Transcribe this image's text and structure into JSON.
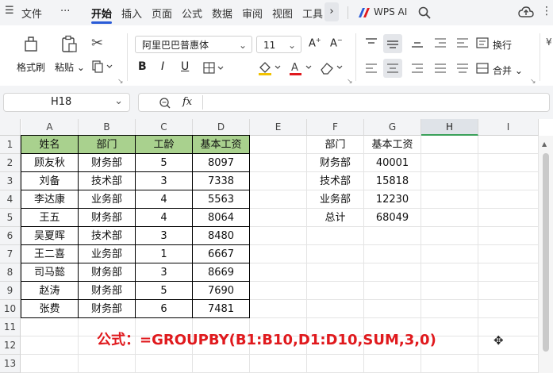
{
  "menu": {
    "file_label": "文件",
    "more_label": "···",
    "tabs": [
      "开始",
      "插入",
      "页面",
      "公式",
      "数据",
      "审阅",
      "视图",
      "工具"
    ],
    "active_tab": "开始",
    "wps_ai_label": "WPS AI"
  },
  "ribbon": {
    "format_painter_label": "格式刷",
    "paste_label": "粘贴",
    "font_name": "阿里巴巴普惠体",
    "font_size": "11",
    "wrap_label": "换行",
    "merge_label": "合并",
    "bold_glyph": "B",
    "italic_glyph": "I",
    "underline_glyph": "U"
  },
  "formula_bar": {
    "cell_ref": "H18",
    "fx_label": "fx",
    "value": ""
  },
  "grid": {
    "columns": [
      "A",
      "B",
      "C",
      "D",
      "E",
      "F",
      "G",
      "H",
      "I"
    ],
    "selected_column": "H",
    "rows": [
      "1",
      "2",
      "3",
      "4",
      "5",
      "6",
      "7",
      "8",
      "9",
      "10",
      "11",
      "12",
      "13"
    ],
    "table": {
      "header": [
        "姓名",
        "部门",
        "工龄",
        "基本工资"
      ],
      "rows": [
        [
          "顾友秋",
          "财务部",
          "5",
          "8097"
        ],
        [
          "刘备",
          "技术部",
          "3",
          "7338"
        ],
        [
          "李达康",
          "业务部",
          "4",
          "5563"
        ],
        [
          "王五",
          "财务部",
          "4",
          "8064"
        ],
        [
          "吴夏晖",
          "技术部",
          "3",
          "8480"
        ],
        [
          "王二喜",
          "业务部",
          "1",
          "6667"
        ],
        [
          "司马懿",
          "财务部",
          "3",
          "8669"
        ],
        [
          "赵涛",
          "财务部",
          "5",
          "7690"
        ],
        [
          "张费",
          "财务部",
          "6",
          "7481"
        ]
      ]
    },
    "summary": {
      "header": [
        "部门",
        "基本工资"
      ],
      "rows": [
        [
          "财务部",
          "40001"
        ],
        [
          "技术部",
          "15818"
        ],
        [
          "业务部",
          "12230"
        ],
        [
          "总计",
          "68049"
        ]
      ]
    }
  },
  "formula_note": "公式：=GROUPBY(B1:B10,D1:D10,SUM,3,0)",
  "colors": {
    "header_fill": "#a9d18e",
    "note_red": "#e0191d",
    "accent_blue": "#2a5bd7"
  }
}
